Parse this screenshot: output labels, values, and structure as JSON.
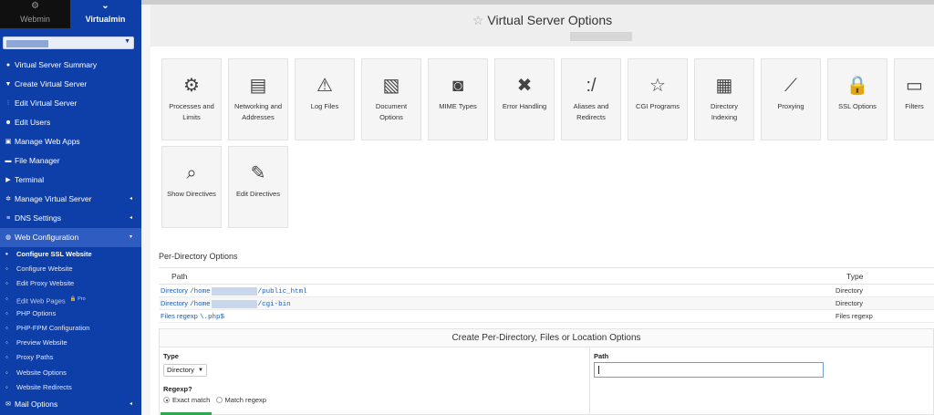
{
  "top_tabs": {
    "webmin": {
      "label": "Webmin",
      "icon": "gear-cluster-icon"
    },
    "virtualmin": {
      "label": "Virtualmin",
      "icon": "chevron-down-icon"
    }
  },
  "domain_selector": {
    "value": ""
  },
  "sidebar": {
    "items": [
      {
        "label": "Virtual Server Summary",
        "icon": "info-icon",
        "caret": ""
      },
      {
        "label": "Create Virtual Server",
        "icon": "filter-icon",
        "caret": ""
      },
      {
        "label": "Edit Virtual Server",
        "icon": "sliders-icon",
        "caret": ""
      },
      {
        "label": "Edit Users",
        "icon": "users-icon",
        "caret": ""
      },
      {
        "label": "Manage Web Apps",
        "icon": "web-apps-icon",
        "caret": ""
      },
      {
        "label": "File Manager",
        "icon": "folder-icon",
        "caret": ""
      },
      {
        "label": "Terminal",
        "icon": "terminal-icon",
        "caret": ""
      },
      {
        "label": "Manage Virtual Server",
        "icon": "cogs-icon",
        "caret": "◂"
      },
      {
        "label": "DNS Settings",
        "icon": "server-icon",
        "caret": "◂"
      },
      {
        "label": "Web Configuration",
        "icon": "globe-icon",
        "caret": "▾"
      }
    ],
    "sub_items": [
      {
        "label": "Configure SSL Website",
        "pro": ""
      },
      {
        "label": "Configure Website",
        "pro": ""
      },
      {
        "label": "Edit Proxy Website",
        "pro": ""
      },
      {
        "label": "Edit Web Pages",
        "pro": "🔒 Pro"
      },
      {
        "label": "PHP Options",
        "pro": ""
      },
      {
        "label": "PHP-FPM Configuration",
        "pro": ""
      },
      {
        "label": "Preview Website",
        "pro": ""
      },
      {
        "label": "Proxy Paths",
        "pro": ""
      },
      {
        "label": "Website Options",
        "pro": ""
      },
      {
        "label": "Website Redirects",
        "pro": ""
      }
    ],
    "last_item": {
      "label": "Mail Options",
      "icon": "envelope-icon",
      "caret": "◂"
    }
  },
  "page": {
    "title": "Virtual Server Options",
    "title_icon": "star-outline-icon"
  },
  "tiles": [
    {
      "label": "Processes and Limits",
      "icon": "gears-icon"
    },
    {
      "label": "Networking and Addresses",
      "icon": "network-icon"
    },
    {
      "label": "Log Files",
      "icon": "warning-icon"
    },
    {
      "label": "Document Options",
      "icon": "document-icon"
    },
    {
      "label": "MIME Types",
      "icon": "mime-icon"
    },
    {
      "label": "Error Handling",
      "icon": "error-x-icon"
    },
    {
      "label": "Aliases and Redirects",
      "icon": "alias-icon"
    },
    {
      "label": "CGI Programs",
      "icon": "star-icon"
    },
    {
      "label": "Directory Indexing",
      "icon": "folder-index-icon"
    },
    {
      "label": "Proxying",
      "icon": "proxy-icon"
    },
    {
      "label": "SSL Options",
      "icon": "padlock-icon"
    },
    {
      "label": "Filters",
      "icon": "filter-printer-icon"
    },
    {
      "label": "Show Directives",
      "icon": "magnifier-icon"
    },
    {
      "label": "Edit Directives",
      "icon": "edit-pen-icon"
    }
  ],
  "per_directory": {
    "title": "Per-Directory Options",
    "columns": [
      "Path",
      "Type"
    ],
    "rows": [
      {
        "prefix": "Directory",
        "path_start": "/home",
        "path_end": "/public_html",
        "type": "Directory"
      },
      {
        "prefix": "Directory",
        "path_start": "/home",
        "path_end": "/cgi-bin",
        "type": "Directory"
      },
      {
        "prefix": "Files regexp",
        "path_start": "\\.php$",
        "path_end": "",
        "type": "Files regexp"
      }
    ]
  },
  "create_form": {
    "title": "Create Per-Directory, Files or Location Options",
    "type_label": "Type",
    "type_value": "Directory",
    "path_label": "Path",
    "path_value": "",
    "regexp_label": "Regexp?",
    "regexp_options": [
      "Exact match",
      "Match regexp"
    ],
    "regexp_selected": "Exact match"
  },
  "colors": {
    "sidebar_bg": "#0e3ea8",
    "sidebar_open_bg": "#2f5cc0",
    "link": "#1b5eb8",
    "accent_green": "#2fa84f"
  }
}
